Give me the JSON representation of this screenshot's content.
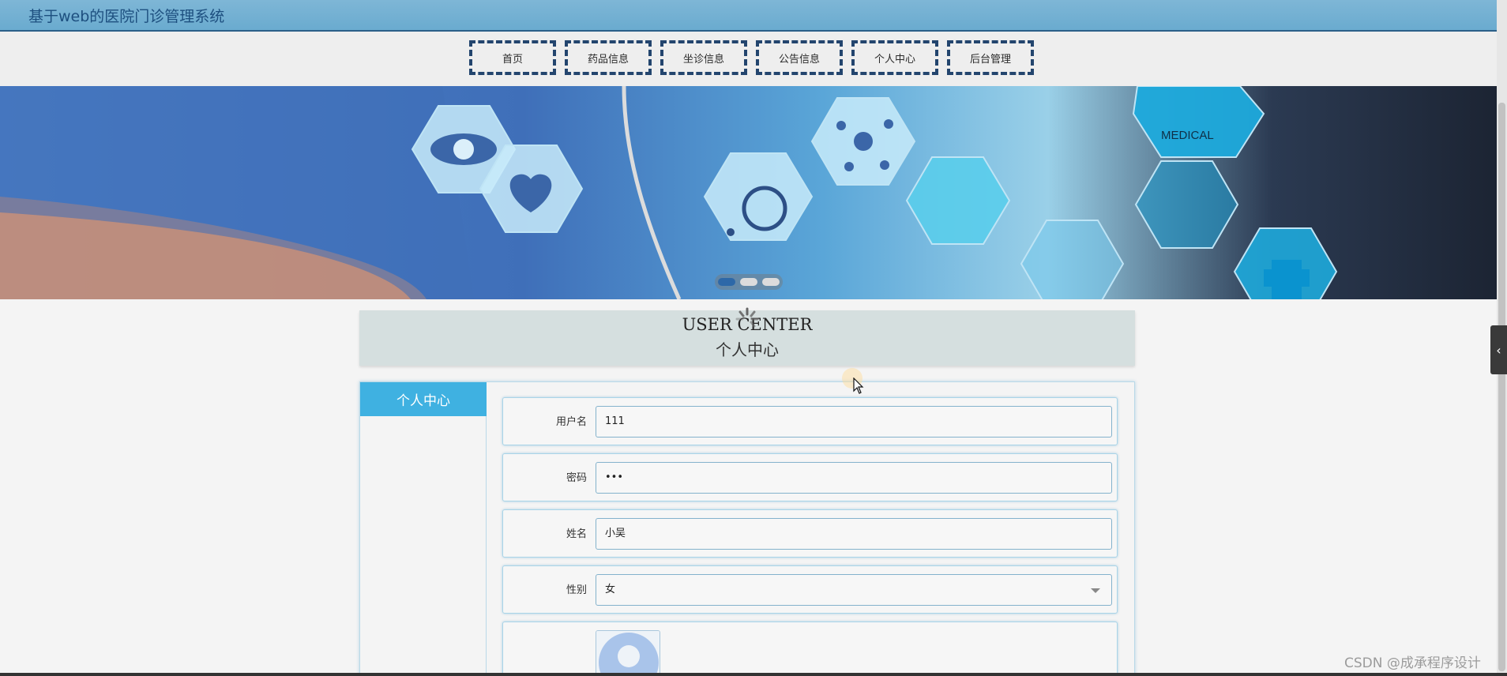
{
  "site": {
    "title": "基于web的医院门诊管理系统"
  },
  "nav": {
    "items": [
      {
        "label": "首页"
      },
      {
        "label": "药品信息"
      },
      {
        "label": "坐诊信息"
      },
      {
        "label": "公告信息"
      },
      {
        "label": "个人中心"
      },
      {
        "label": "后台管理"
      }
    ]
  },
  "banner": {
    "medical_text": "MEDICAL",
    "slides": 3,
    "active_slide": 1
  },
  "section": {
    "title_en": "USER CENTER",
    "title_cn": "个人中心"
  },
  "side_menu": {
    "items": [
      {
        "label": "个人中心"
      }
    ]
  },
  "form": {
    "username": {
      "label": "用户名",
      "value": "111"
    },
    "password": {
      "label": "密码",
      "value": "•••"
    },
    "name": {
      "label": "姓名",
      "value": "小吴"
    },
    "gender": {
      "label": "性别",
      "value": "女"
    }
  },
  "watermark": "CSDN @成承程序设计",
  "colors": {
    "header": "#6aabcf",
    "nav_border": "#23456e",
    "side_menu_active": "#3fb1e1"
  },
  "icons": [
    "eye-icon",
    "heart-icon",
    "wheelchair-icon",
    "molecule-icon",
    "syringe-icon",
    "microscope-icon",
    "medical-cross-icon",
    "test-tubes-icon",
    "avatar-placeholder-icon"
  ]
}
